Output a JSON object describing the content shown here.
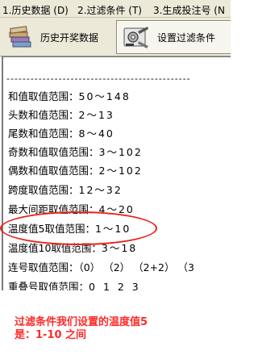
{
  "menu": {
    "items": [
      {
        "label": "1.历史数据 (D)"
      },
      {
        "label": "2.过滤条件 (T)"
      },
      {
        "label": "3.生成投注号 (N"
      }
    ]
  },
  "toolbar": {
    "history_label": "历史开奖数据",
    "filter_label": "设置过滤条件"
  },
  "panel": {
    "separator": "----------------------------------------------",
    "rows": [
      {
        "label": "和值取值范围：",
        "value": "50～148"
      },
      {
        "label": "头数和值范围：",
        "value": "2～13"
      },
      {
        "label": "尾数和值范围：",
        "value": "8～40"
      },
      {
        "label": "奇数和值取值范围：",
        "value": "3～102"
      },
      {
        "label": "偶数和值取值范围：",
        "value": "2～102"
      },
      {
        "label": "跨度取值范围：",
        "value": "12～32"
      },
      {
        "label": "最大间距取值范围：",
        "value": "4～20"
      },
      {
        "label": "温度值5取值范围：",
        "value": "1～10"
      },
      {
        "label": "温度值10取值范围：",
        "value": "3～18"
      },
      {
        "label": "连号取值范围：",
        "value": "（0） （2） （2+2） （3"
      },
      {
        "label": "重叠号取值范围：",
        "value": "0 1 2 3"
      }
    ]
  },
  "annotation": {
    "line1": "过滤条件我们设置的温度值5",
    "line2": "是：1-10 之间"
  },
  "colors": {
    "highlight": "#e8231c",
    "annotation": "#ff2a2a"
  }
}
